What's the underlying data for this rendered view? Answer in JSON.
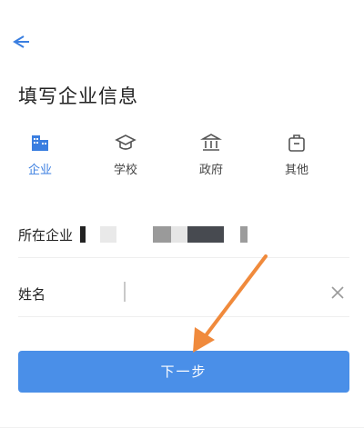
{
  "header": {
    "title": "填写企业信息"
  },
  "org_types": [
    {
      "label": "企业",
      "icon": "building-icon",
      "active": true
    },
    {
      "label": "学校",
      "icon": "graduation-cap-icon",
      "active": false
    },
    {
      "label": "政府",
      "icon": "government-icon",
      "active": false
    },
    {
      "label": "其他",
      "icon": "briefcase-icon",
      "active": false
    }
  ],
  "form": {
    "company_label": "所在企业",
    "name_label": "姓名"
  },
  "next_button": {
    "label": "下一步"
  },
  "colors": {
    "accent": "#3a7ee0",
    "button": "#4a8fe8",
    "annotation": "#f08a3c"
  }
}
